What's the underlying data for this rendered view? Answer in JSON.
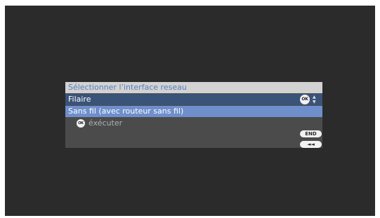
{
  "dialog": {
    "title": "Sélectionner l’interface reseau",
    "options": [
      {
        "label": "Filaire"
      },
      {
        "label": "Sans fil (avec routeur sans fil)"
      }
    ],
    "ok_badge": "OK",
    "navigate_arrows": {
      "up": "▲",
      "down": "▼"
    },
    "hint_label": "éxécuter",
    "end_button": "END",
    "back_button": "◄◄"
  },
  "colors": {
    "screen_bg": "#2b2b2b",
    "dialog_bg": "#4b4b4b",
    "title_bar": "#d2d2d2",
    "title_text": "#5a7dbe",
    "row_focused": "#3a5379",
    "row_selected": "#6f8fcc"
  }
}
